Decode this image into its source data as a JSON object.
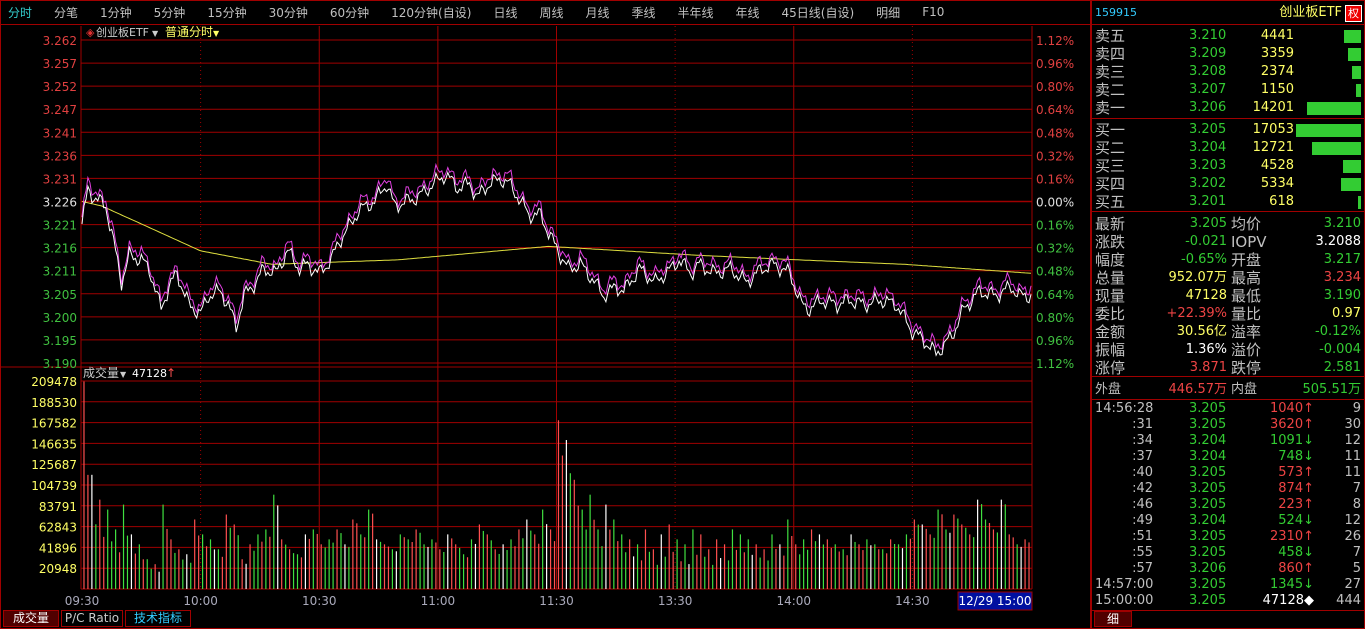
{
  "topbar": [
    "分时",
    "分笔",
    "1分钟",
    "5分钟",
    "15分钟",
    "30分钟",
    "60分钟",
    "120分钟(自设)",
    "日线",
    "周线",
    "月线",
    "季线",
    "半年线",
    "年线",
    "45日线(自设)",
    "明细",
    "F10"
  ],
  "chart_header": {
    "name": "创业板ETF",
    "mode": "普通分时"
  },
  "volume_header": {
    "label": "成交量",
    "value": "47128",
    "arrow": "↑"
  },
  "bottom_tabs": [
    "成交量",
    "P/C Ratio",
    "技术指标"
  ],
  "cursor_label": "12/29 15:00",
  "colors": {
    "bg": "#000000",
    "grid": "#a00000",
    "price": "#ffffff",
    "price2": "#e040e0",
    "avg": "#e0e040",
    "up": "#ff5050",
    "down": "#40e040"
  },
  "chart_data": {
    "type": "line",
    "price_ticks": [
      "3.262",
      "3.257",
      "3.252",
      "3.247",
      "3.241",
      "3.236",
      "3.231",
      "3.226",
      "3.221",
      "3.216",
      "3.211",
      "3.205",
      "3.200",
      "3.195",
      "3.190"
    ],
    "pct_ticks": [
      "1.12%",
      "0.96%",
      "0.80%",
      "0.64%",
      "0.48%",
      "0.32%",
      "0.16%",
      "0.00%",
      "0.16%",
      "0.32%",
      "0.48%",
      "0.64%",
      "0.80%",
      "0.96%",
      "1.12%"
    ],
    "ylim": [
      3.19,
      3.262
    ],
    "prev_close": 3.226,
    "time_labels": [
      "09:30",
      "10:00",
      "10:30",
      "11:00",
      "11:30",
      "13:30",
      "14:00",
      "14:30",
      "15:00"
    ],
    "time_label_minutes": [
      0,
      30,
      60,
      90,
      120,
      150,
      180,
      210,
      240
    ],
    "price_series": [
      [
        0,
        3.221
      ],
      [
        1.5,
        3.2286
      ],
      [
        3,
        3.227
      ],
      [
        6,
        3.225
      ],
      [
        8,
        3.217
      ],
      [
        10,
        3.208
      ],
      [
        12,
        3.214
      ],
      [
        15,
        3.213
      ],
      [
        17,
        3.211
      ],
      [
        20,
        3.202
      ],
      [
        22,
        3.207
      ],
      [
        24,
        3.21
      ],
      [
        27,
        3.203
      ],
      [
        30,
        3.201
      ],
      [
        32,
        3.205
      ],
      [
        35,
        3.206
      ],
      [
        37,
        3.203
      ],
      [
        39,
        3.198
      ],
      [
        41,
        3.205
      ],
      [
        44,
        3.208
      ],
      [
        46,
        3.211
      ],
      [
        49,
        3.21
      ],
      [
        52,
        3.215
      ],
      [
        55,
        3.211
      ],
      [
        57,
        3.212
      ],
      [
        60,
        3.21
      ],
      [
        63,
        3.213
      ],
      [
        65,
        3.217
      ],
      [
        68,
        3.221
      ],
      [
        70,
        3.224
      ],
      [
        74,
        3.226
      ],
      [
        77,
        3.23
      ],
      [
        79,
        3.225
      ],
      [
        82,
        3.226
      ],
      [
        85,
        3.227
      ],
      [
        89,
        3.23
      ],
      [
        92,
        3.232
      ],
      [
        95,
        3.229
      ],
      [
        98,
        3.23
      ],
      [
        100,
        3.227
      ],
      [
        103,
        3.23
      ],
      [
        106,
        3.231
      ],
      [
        108,
        3.23
      ],
      [
        111,
        3.226
      ],
      [
        113,
        3.223
      ],
      [
        116,
        3.223
      ],
      [
        118,
        3.219
      ],
      [
        121,
        3.214
      ],
      [
        123,
        3.211
      ],
      [
        126,
        3.212
      ],
      [
        128,
        3.21
      ],
      [
        132,
        3.205
      ],
      [
        135,
        3.207
      ],
      [
        137,
        3.206
      ],
      [
        141,
        3.211
      ],
      [
        145,
        3.208
      ],
      [
        149,
        3.211
      ],
      [
        151,
        3.213
      ],
      [
        154,
        3.21
      ],
      [
        156,
        3.212
      ],
      [
        160,
        3.21
      ],
      [
        164,
        3.211
      ],
      [
        168,
        3.208
      ],
      [
        172,
        3.211
      ],
      [
        175,
        3.212
      ],
      [
        179,
        3.21
      ],
      [
        182,
        3.203
      ],
      [
        184,
        3.202
      ],
      [
        187,
        3.204
      ],
      [
        191,
        3.203
      ],
      [
        194,
        3.204
      ],
      [
        198,
        3.203
      ],
      [
        202,
        3.204
      ],
      [
        206,
        3.203
      ],
      [
        210,
        3.197
      ],
      [
        213,
        3.195
      ],
      [
        216,
        3.192
      ],
      [
        220,
        3.196
      ],
      [
        223,
        3.202
      ],
      [
        227,
        3.206
      ],
      [
        231,
        3.205
      ],
      [
        235,
        3.207
      ],
      [
        237,
        3.205
      ],
      [
        240,
        3.205
      ]
    ],
    "avg_series": [
      [
        0,
        3.226
      ],
      [
        5,
        3.225
      ],
      [
        30,
        3.215
      ],
      [
        48,
        3.212
      ],
      [
        80,
        3.213
      ],
      [
        118,
        3.216
      ],
      [
        156,
        3.214
      ],
      [
        181,
        3.213
      ],
      [
        208,
        3.212
      ],
      [
        240,
        3.21
      ]
    ],
    "volume_ticks": [
      "209478",
      "188530",
      "167582",
      "146635",
      "125687",
      "104739",
      "83791",
      "62843",
      "41896",
      "20948"
    ],
    "volume_max": 209478,
    "volume_k": [
      209,
      115,
      90,
      80,
      60,
      85,
      55,
      45,
      30,
      25,
      85,
      50,
      40,
      35,
      70,
      55,
      50,
      40,
      75,
      65,
      30,
      45,
      55,
      60,
      95,
      50,
      40,
      35,
      55,
      60,
      45,
      50,
      60,
      45,
      70,
      55,
      80,
      50,
      45,
      40,
      55,
      50,
      60,
      45,
      50,
      40,
      55,
      45,
      35,
      50,
      65,
      55,
      40,
      45,
      50,
      60,
      70,
      55,
      80,
      60,
      170,
      150,
      110,
      80,
      95,
      60,
      85,
      70,
      55,
      50,
      45,
      60,
      40,
      55,
      65,
      50,
      45,
      60,
      55,
      40,
      50,
      45,
      60,
      55,
      50,
      45,
      40,
      55,
      45,
      70,
      45,
      50,
      60,
      55,
      50,
      45,
      40,
      55,
      45,
      50,
      45,
      40,
      50,
      45,
      55,
      70,
      65,
      55,
      80,
      60,
      75,
      65,
      55,
      90,
      70,
      60,
      90,
      55,
      45,
      50
    ],
    "volume_colors": "rrwgrrgggrggwrgrggrwgrrgrgwgrrgrgwgrrgrgrwrggrgrgwrgrggrwrgrrgggrgwgrrgrgrwgrrgwgrgrrggwgrrgwrrggrgwrgrgrgwggrrgwgrrgwrr"
  },
  "quote": {
    "code": "159915",
    "name": "创业板ETF",
    "badge": "权",
    "sell": [
      {
        "label": "卖五",
        "price": "3.210",
        "vol": "4441",
        "ratio": 0.26
      },
      {
        "label": "卖四",
        "price": "3.209",
        "vol": "3359",
        "ratio": 0.2
      },
      {
        "label": "卖三",
        "price": "3.208",
        "vol": "2374",
        "ratio": 0.14
      },
      {
        "label": "卖二",
        "price": "3.207",
        "vol": "1150",
        "ratio": 0.07
      },
      {
        "label": "卖一",
        "price": "3.206",
        "vol": "14201",
        "ratio": 0.83
      }
    ],
    "buy": [
      {
        "label": "买一",
        "price": "3.205",
        "vol": "17053",
        "ratio": 1.0
      },
      {
        "label": "买二",
        "price": "3.204",
        "vol": "12721",
        "ratio": 0.75
      },
      {
        "label": "买三",
        "price": "3.203",
        "vol": "4528",
        "ratio": 0.27
      },
      {
        "label": "买四",
        "price": "3.202",
        "vol": "5334",
        "ratio": 0.31
      },
      {
        "label": "买五",
        "price": "3.201",
        "vol": "618",
        "ratio": 0.04
      }
    ],
    "stats": [
      {
        "l1": "最新",
        "v1": "3.205",
        "c1": "g",
        "l2": "均价",
        "v2": "3.210",
        "c2": "g"
      },
      {
        "l1": "涨跌",
        "v1": "-0.021",
        "c1": "g",
        "l2": "IOPV",
        "v2": "3.2088",
        "c2": "w"
      },
      {
        "l1": "幅度",
        "v1": "-0.65%",
        "c1": "g",
        "l2": "开盘",
        "v2": "3.217",
        "c2": "g"
      },
      {
        "l1": "总量",
        "v1": "952.07万",
        "c1": "y",
        "l2": "最高",
        "v2": "3.234",
        "c2": "r"
      },
      {
        "l1": "现量",
        "v1": "47128",
        "c1": "y",
        "l2": "最低",
        "v2": "3.190",
        "c2": "g"
      },
      {
        "l1": "委比",
        "v1": "+22.39%",
        "c1": "r",
        "l2": "量比",
        "v2": "0.97",
        "c2": "y"
      },
      {
        "l1": "金额",
        "v1": "30.56亿",
        "c1": "y",
        "l2": "溢率",
        "v2": "-0.12%",
        "c2": "g"
      },
      {
        "l1": "振幅",
        "v1": "1.36%",
        "c1": "w",
        "l2": "溢价",
        "v2": "-0.004",
        "c2": "g"
      },
      {
        "l1": "涨停",
        "v1": "3.871",
        "c1": "r",
        "l2": "跌停",
        "v2": "2.581",
        "c2": "g"
      }
    ],
    "outer": {
      "label": "外盘",
      "value": "446.57万",
      "label2": "内盘",
      "value2": "505.51万"
    },
    "ticks": [
      {
        "t": "14:56:28",
        "p": "3.205",
        "v": "1040↑",
        "c": "r",
        "n": "9"
      },
      {
        "t": ":31",
        "p": "3.205",
        "v": "3620↑",
        "c": "r",
        "n": "30"
      },
      {
        "t": ":34",
        "p": "3.204",
        "v": "1091↓",
        "c": "g",
        "n": "12"
      },
      {
        "t": ":37",
        "p": "3.204",
        "v": "748↓",
        "c": "g",
        "n": "11"
      },
      {
        "t": ":40",
        "p": "3.205",
        "v": "573↑",
        "c": "r",
        "n": "11"
      },
      {
        "t": ":42",
        "p": "3.205",
        "v": "874↑",
        "c": "r",
        "n": "7"
      },
      {
        "t": ":46",
        "p": "3.205",
        "v": "223↑",
        "c": "r",
        "n": "8"
      },
      {
        "t": ":49",
        "p": "3.204",
        "v": "524↓",
        "c": "g",
        "n": "12"
      },
      {
        "t": ":51",
        "p": "3.205",
        "v": "2310↑",
        "c": "r",
        "n": "26"
      },
      {
        "t": ":55",
        "p": "3.205",
        "v": "458↓",
        "c": "g",
        "n": "7"
      },
      {
        "t": ":57",
        "p": "3.206",
        "v": "860↑",
        "c": "r",
        "n": "5"
      },
      {
        "t": "14:57:00",
        "p": "3.205",
        "v": "1345↓",
        "c": "g",
        "n": "27"
      },
      {
        "t": "15:00:00",
        "p": "3.205",
        "v": "47128◆",
        "c": "w",
        "n": "444"
      }
    ],
    "detail_tab": "细"
  }
}
